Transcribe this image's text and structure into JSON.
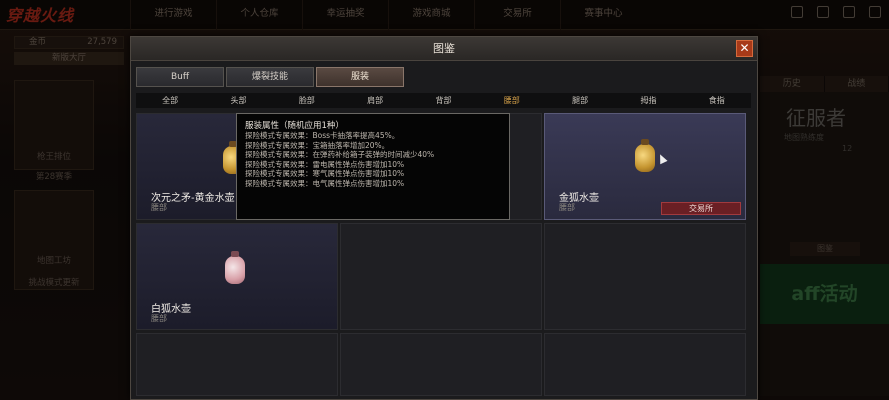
{
  "background": {
    "logo": "穿越火线",
    "topnav": [
      "进行游戏",
      "个人仓库",
      "幸运抽奖",
      "游戏商城",
      "交易所",
      "赛事中心"
    ],
    "coin": {
      "label": "金币",
      "value": "27,579"
    },
    "season_tab": "新版大厅",
    "side_labels": [
      "枪王排位",
      "第28赛季",
      "地图工坊",
      "挑战模式更新"
    ],
    "right_tabs": [
      "历史",
      "战绩"
    ],
    "conquer_title": "征服者",
    "conquer_sub": "地图熟练度",
    "conquer_num": "12",
    "guide": "图鉴",
    "activity": "aff活动"
  },
  "dialog": {
    "title": "图鉴",
    "close_label": "✕",
    "category_tabs": [
      {
        "label": "Buff",
        "active": false
      },
      {
        "label": "爆裂技能",
        "active": false
      },
      {
        "label": "服装",
        "active": true
      }
    ],
    "part_tabs": [
      {
        "label": "全部",
        "active": false
      },
      {
        "label": "头部",
        "active": false
      },
      {
        "label": "脸部",
        "active": false
      },
      {
        "label": "肩部",
        "active": false
      },
      {
        "label": "背部",
        "active": false
      },
      {
        "label": "腰部",
        "active": true
      },
      {
        "label": "腿部",
        "active": false
      },
      {
        "label": "拇指",
        "active": false
      },
      {
        "label": "食指",
        "active": false
      }
    ],
    "items": [
      {
        "name": "次元之矛-黄金水壶",
        "part": "腰部"
      },
      {
        "name": "金狐水壶",
        "part": "腰部",
        "button": "交易所"
      },
      {
        "name": "白狐水壶",
        "part": "腰部"
      }
    ],
    "tooltip": {
      "title": "服装属性（随机应用1种）",
      "lines": [
        "探险模式专属效果：Boss卡抽落率提高45%。",
        "探险模式专属效果：宝箱抽落率增加20%。",
        "探险模式专属效果：在弹药补给箱子装弹的时间减少40%",
        "探险模式专属效果：雷电属性弹点伤害增加10%",
        "探险模式专属效果：寒气属性弹点伤害增加10%",
        "探险模式专属效果：电气属性弹点伤害增加10%"
      ]
    }
  }
}
